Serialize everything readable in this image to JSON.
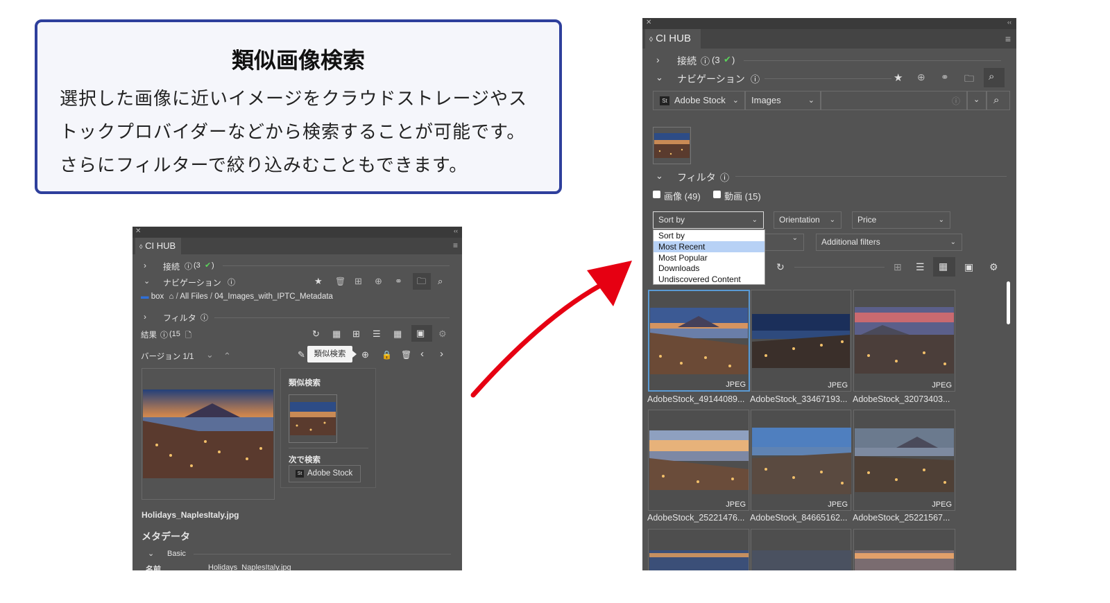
{
  "callout": {
    "title": "類似画像検索",
    "line1": "選択した画像に近いイメージをクラウドストレージやス",
    "line2": "トックプロバイダーなどから検索することが可能です。",
    "line3": "さらにフィルターで絞り込みむこともできます。"
  },
  "left_panel": {
    "tab": "CI HUB",
    "connect_label": "接続",
    "connect_count": "(3",
    "connect_close": ")",
    "nav_label": "ナビゲーション",
    "breadcrumb": {
      "root": "box",
      "p1": "All Files",
      "sep": "/",
      "p2": "04_Images_with_IPTC_Metadata"
    },
    "filter_label": "フィルタ",
    "results_label": "結果",
    "results_count": "(15",
    "version_label": "バージョン 1/1",
    "tooltip": "類似検索",
    "similar_title": "類似検索",
    "next_search": "次で検索",
    "provider_button": "Adobe Stock",
    "filename": "Holidays_NaplesItaly.jpg",
    "metadata_title": "メタデータ",
    "basic_label": "Basic",
    "name_label": "名前",
    "name_value": "Holidays_NaplesItaly.jpg"
  },
  "right_panel": {
    "tab": "CI HUB",
    "connect_label": "接続",
    "connect_count": "(3",
    "connect_close": ")",
    "nav_label": "ナビゲーション",
    "source_select": "Adobe Stock",
    "type_select": "Images",
    "filter_label": "フィルタ",
    "checkbox_image": "画像 (49)",
    "checkbox_video": "動画 (15)",
    "sort_select": "Sort by",
    "orientation_select": "Orientation",
    "price_select": "Price",
    "additional_filters": "Additional filters",
    "sort_options": [
      "Sort by",
      "Most Recent",
      "Most Popular",
      "Downloads",
      "Undiscovered Content"
    ],
    "sort_highlighted": "Most Recent",
    "results": [
      {
        "caption": "AdobeStock_49144089...",
        "format": "JPEG"
      },
      {
        "caption": "AdobeStock_33467193...",
        "format": "JPEG"
      },
      {
        "caption": "AdobeStock_32073403...",
        "format": "JPEG"
      },
      {
        "caption": "AdobeStock_25221476...",
        "format": "JPEG"
      },
      {
        "caption": "AdobeStock_84665162...",
        "format": "JPEG"
      },
      {
        "caption": "AdobeStock_25221567...",
        "format": "JPEG"
      }
    ]
  },
  "colors": {
    "panel_bg": "#535353",
    "callout_border": "#2e3f9c",
    "arrow": "#e60012",
    "selection": "#5b9bd5",
    "check_green": "#5bd35b"
  }
}
